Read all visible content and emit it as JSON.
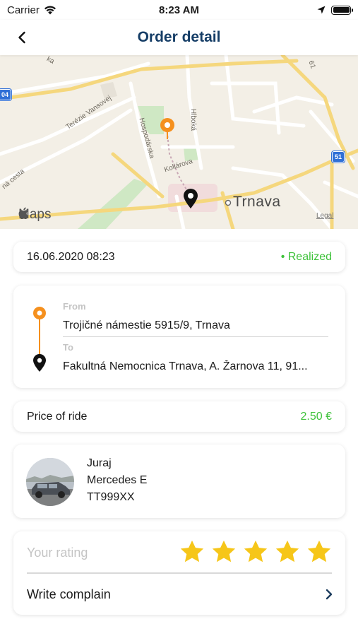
{
  "status_bar": {
    "carrier": "Carrier",
    "time": "8:23 AM",
    "battery_level": 1.0
  },
  "nav": {
    "title": "Order detail",
    "back_icon": "chevron-left-icon"
  },
  "map": {
    "city": "Trnava",
    "attribution": "Maps",
    "legal": "Legal",
    "streets": [
      "Terézie Vansovej",
      "Hospodárska",
      "Hlboká",
      "Kollárova",
      "ná cesta",
      "ka"
    ],
    "shields": [
      "04",
      "51"
    ],
    "road_number": "61",
    "origin_pin_color": "#f5901e",
    "destination_pin_color": "#111111"
  },
  "order": {
    "datetime": "16.06.2020 08:23",
    "status": "• Realized",
    "status_color": "#3fc23b"
  },
  "route": {
    "from_label": "From",
    "from_value": "Trojičné námestie 5915/9, Trnava",
    "to_label": "To",
    "to_value": "Fakultná Nemocnica Trnava, A. Žarnova 11, 91..."
  },
  "price": {
    "label": "Price of ride",
    "value": "2.50 €"
  },
  "driver": {
    "name": "Juraj",
    "car": "Mercedes E",
    "plate": "TT999XX"
  },
  "rating": {
    "label": "Your rating",
    "stars": 5,
    "max_stars": 5,
    "star_color": "#f6c619",
    "complain_label": "Write complain"
  },
  "colors": {
    "title": "#153d66",
    "accent_green": "#3fc23b",
    "accent_orange": "#f5901e"
  }
}
